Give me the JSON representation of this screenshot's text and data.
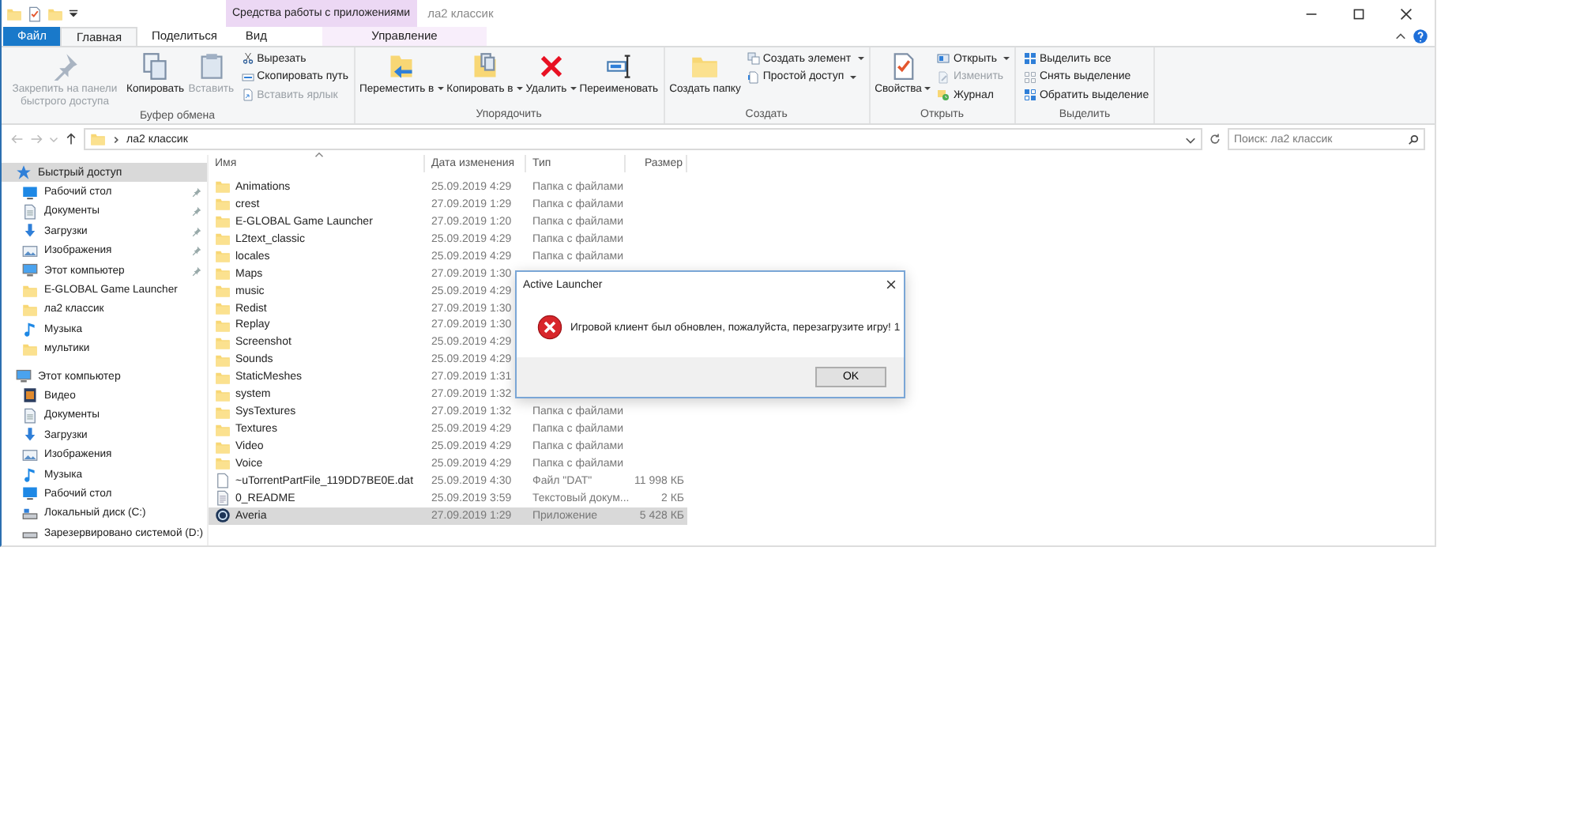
{
  "window": {
    "title": "ла2 классик",
    "context_group": "Средства работы с приложениями"
  },
  "tabs": [
    {
      "label": "Файл",
      "kind": "file",
      "selected": false
    },
    {
      "label": "Главная",
      "kind": "tab",
      "selected": true
    },
    {
      "label": "Поделиться",
      "kind": "tab",
      "selected": false
    },
    {
      "label": "Вид",
      "kind": "tab",
      "selected": false
    },
    {
      "label": "Управление",
      "kind": "context",
      "selected": false
    }
  ],
  "ribbon": {
    "groups": [
      {
        "label": "Буфер обмена",
        "big": [
          {
            "label": "Закрепить на панели быстрого доступа",
            "disabled": true,
            "dropdown": false
          },
          {
            "label": "Копировать",
            "disabled": false,
            "dropdown": false
          },
          {
            "label": "Вставить",
            "disabled": true,
            "dropdown": false
          }
        ],
        "small": [
          {
            "label": "Вырезать",
            "disabled": false,
            "dropdown": false
          },
          {
            "label": "Скопировать путь",
            "disabled": false,
            "dropdown": false
          },
          {
            "label": "Вставить ярлык",
            "disabled": true,
            "dropdown": false
          }
        ]
      },
      {
        "label": "Упорядочить",
        "big": [
          {
            "label": "Переместить в",
            "disabled": false,
            "dropdown": true
          },
          {
            "label": "Копировать в",
            "disabled": false,
            "dropdown": true
          },
          {
            "label": "Удалить",
            "disabled": false,
            "dropdown": true
          },
          {
            "label": "Переименовать",
            "disabled": false,
            "dropdown": false
          }
        ]
      },
      {
        "label": "Создать",
        "big": [
          {
            "label": "Создать папку",
            "disabled": false,
            "dropdown": false
          }
        ],
        "small": [
          {
            "label": "Создать элемент",
            "disabled": false,
            "dropdown": true
          },
          {
            "label": "Простой доступ",
            "disabled": false,
            "dropdown": true
          }
        ]
      },
      {
        "label": "Открыть",
        "big": [
          {
            "label": "Свойства",
            "disabled": false,
            "dropdown": true
          }
        ],
        "small": [
          {
            "label": "Открыть",
            "disabled": false,
            "dropdown": true
          },
          {
            "label": "Изменить",
            "disabled": true,
            "dropdown": false
          },
          {
            "label": "Журнал",
            "disabled": false,
            "dropdown": false
          }
        ]
      },
      {
        "label": "Выделить",
        "small": [
          {
            "label": "Выделить все",
            "disabled": false,
            "dropdown": false
          },
          {
            "label": "Снять выделение",
            "disabled": false,
            "dropdown": false
          },
          {
            "label": "Обратить выделение",
            "disabled": false,
            "dropdown": false
          }
        ]
      }
    ]
  },
  "address": {
    "path": "ла2 классик",
    "search": {
      "placeholder": "Поиск: ла2 классик"
    }
  },
  "sidebar": {
    "items": [
      {
        "label": "Быстрый доступ",
        "selected": true,
        "children": [
          {
            "label": "Рабочий стол",
            "pinned": true,
            "selected": false
          },
          {
            "label": "Документы",
            "pinned": true,
            "selected": false
          },
          {
            "label": "Загрузки",
            "pinned": true,
            "selected": false
          },
          {
            "label": "Изображения",
            "pinned": true,
            "selected": false
          },
          {
            "label": "Этот компьютер",
            "pinned": true,
            "selected": false
          },
          {
            "label": "E-GLOBAL Game Launcher",
            "pinned": false,
            "selected": false
          },
          {
            "label": "ла2 классик",
            "pinned": false,
            "selected": false
          },
          {
            "label": "Музыка",
            "pinned": false,
            "selected": false
          },
          {
            "label": "мультики",
            "pinned": false,
            "selected": false
          }
        ]
      },
      {
        "label": "Этот компьютер",
        "selected": false,
        "children": [
          {
            "label": "Видео",
            "pinned": false,
            "selected": false
          },
          {
            "label": "Документы",
            "pinned": false,
            "selected": false
          },
          {
            "label": "Загрузки",
            "pinned": false,
            "selected": false
          },
          {
            "label": "Изображения",
            "pinned": false,
            "selected": false
          },
          {
            "label": "Музыка",
            "pinned": false,
            "selected": false
          },
          {
            "label": "Рабочий стол",
            "pinned": false,
            "selected": false
          },
          {
            "label": "Локальный диск (C:)",
            "pinned": false,
            "selected": false
          },
          {
            "label": "Зарезервировано системой (D:)",
            "pinned": false,
            "selected": false
          }
        ]
      }
    ]
  },
  "table": {
    "columns": [
      "Имя",
      "Дата изменения",
      "Тип",
      "Размер"
    ],
    "rows": [
      {
        "kind": "folder",
        "name": "Animations",
        "date": "25.09.2019 4:29",
        "type": "Папка с файлами",
        "selected": false
      },
      {
        "kind": "folder",
        "name": "crest",
        "date": "27.09.2019 1:29",
        "type": "Папка с файлами",
        "selected": false
      },
      {
        "kind": "folder",
        "name": "E-GLOBAL Game Launcher",
        "date": "27.09.2019 1:20",
        "type": "Папка с файлами",
        "selected": false
      },
      {
        "kind": "folder",
        "name": "L2text_classic",
        "date": "25.09.2019 4:29",
        "type": "Папка с файлами",
        "selected": false
      },
      {
        "kind": "folder",
        "name": "locales",
        "date": "25.09.2019 4:29",
        "type": "Папка с файлами",
        "selected": false
      },
      {
        "kind": "folder",
        "name": "Maps",
        "date": "27.09.2019 1:30",
        "selected": false
      },
      {
        "kind": "folder",
        "name": "music",
        "date": "25.09.2019 4:29",
        "selected": false
      },
      {
        "kind": "folder",
        "name": "Redist",
        "date": "27.09.2019 1:30",
        "selected": false
      },
      {
        "kind": "folder",
        "name": "Replay",
        "date": "27.09.2019 1:30",
        "selected": false
      },
      {
        "kind": "folder",
        "name": "Screenshot",
        "date": "25.09.2019 4:29",
        "selected": false
      },
      {
        "kind": "folder",
        "name": "Sounds",
        "date": "25.09.2019 4:29",
        "selected": false
      },
      {
        "kind": "folder",
        "name": "StaticMeshes",
        "date": "27.09.2019 1:31",
        "selected": false
      },
      {
        "kind": "folder",
        "name": "system",
        "date": "27.09.2019 1:32",
        "selected": false
      },
      {
        "kind": "folder",
        "name": "SysTextures",
        "date": "27.09.2019 1:32",
        "type": "Папка с файлами",
        "selected": false
      },
      {
        "kind": "folder",
        "name": "Textures",
        "date": "25.09.2019 4:29",
        "type": "Папка с файлами",
        "selected": false
      },
      {
        "kind": "folder",
        "name": "Video",
        "date": "25.09.2019 4:29",
        "type": "Папка с файлами",
        "selected": false
      },
      {
        "kind": "folder",
        "name": "Voice",
        "date": "25.09.2019 4:29",
        "type": "Папка с файлами",
        "selected": false
      },
      {
        "kind": "file",
        "name": "~uTorrentPartFile_119DD7BE0E.dat",
        "date": "25.09.2019 4:30",
        "type": "Файл \"DAT\"",
        "size": "11 998 КБ",
        "selected": false
      },
      {
        "kind": "text",
        "name": "0_README",
        "date": "25.09.2019 3:59",
        "type": "Текстовый докум...",
        "size": "2 КБ",
        "selected": false
      },
      {
        "kind": "app",
        "name": "Averia",
        "date": "27.09.2019 1:29",
        "type": "Приложение",
        "size": "5 428 КБ",
        "selected": true
      }
    ]
  },
  "dialog": {
    "title": "Active Launcher",
    "message": "Игровой клиент был обновлен, пожалуйста, перезагрузите игру! 1",
    "button": "OK"
  }
}
